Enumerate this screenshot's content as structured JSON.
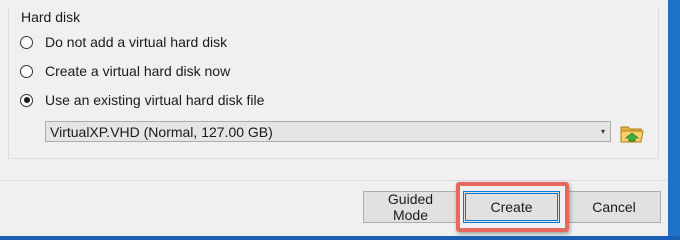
{
  "hard_disk": {
    "group_title": "Hard disk",
    "options": [
      {
        "label": "Do not add a virtual hard disk",
        "selected": false
      },
      {
        "label": "Create a virtual hard disk now",
        "selected": false
      },
      {
        "label": "Use an existing virtual hard disk file",
        "selected": true
      }
    ],
    "existing_disk": {
      "selected_value": "VirtualXP.VHD (Normal, 127.00 GB)",
      "choose_icon": "folder-browse-icon"
    }
  },
  "buttons": {
    "guided_mode": "Guided Mode",
    "create": "Create",
    "cancel": "Cancel"
  },
  "colors": {
    "highlight": "#e8685f",
    "focus": "#0078d7",
    "desktop": "#1e73c8"
  }
}
